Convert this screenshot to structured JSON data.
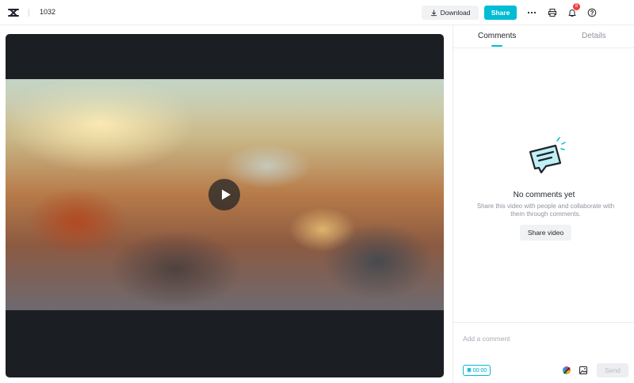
{
  "topbar": {
    "project_title": "1032",
    "download_label": "Download",
    "share_label": "Share",
    "notification_count": "8"
  },
  "player": {
    "state": "paused"
  },
  "side_panel": {
    "tabs": [
      {
        "label": "Comments",
        "active": true
      },
      {
        "label": "Details",
        "active": false
      }
    ],
    "empty_title": "No comments yet",
    "empty_description": "Share this video with people and collaborate with them through comments.",
    "share_video_label": "Share video",
    "comment_placeholder": "Add a comment",
    "timestamp": "00:00",
    "send_label": "Send"
  },
  "colors": {
    "accent": "#00bcd4",
    "badge": "#f23d3d",
    "player_bg": "#1b1f24"
  },
  "icons": [
    "capcut-logo-icon",
    "download-icon",
    "more-icon",
    "print-icon",
    "bell-icon",
    "help-icon",
    "play-icon",
    "comment-bubble-icon",
    "pin-icon",
    "color-wheel-icon",
    "image-icon"
  ]
}
